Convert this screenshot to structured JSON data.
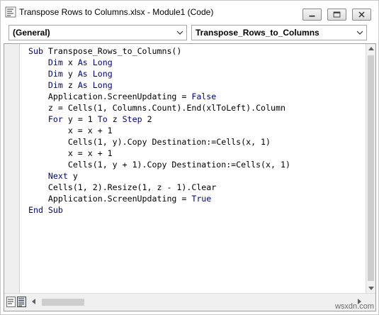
{
  "window": {
    "title": "Transpose Rows to Columns.xlsx - Module1 (Code)",
    "icon": "vba-module-icon"
  },
  "controls": {
    "minimize": "minimize-icon",
    "maximize": "maximize-icon",
    "close": "close-icon"
  },
  "toolbar": {
    "object_combo": "(General)",
    "procedure_combo": "Transpose_Rows_to_Columns"
  },
  "code": {
    "lines": [
      "Sub Transpose_Rows_to_Columns()",
      "    Dim x As Long",
      "    Dim y As Long",
      "    Dim z As Long",
      "    Application.ScreenUpdating = False",
      "    z = Cells(1, Columns.Count).End(xlToLeft).Column",
      "    For y = 1 To z Step 2",
      "        x = x + 1",
      "        Cells(1, y).Copy Destination:=Cells(x, 1)",
      "        x = x + 1",
      "        Cells(1, y + 1).Copy Destination:=Cells(x, 1)",
      "    Next y",
      "    Cells(1, 2).Resize(1, z - 1).Clear",
      "    Application.ScreenUpdating = True",
      "End Sub"
    ]
  },
  "colors": {
    "keyword": "#00008b",
    "text": "#000000"
  },
  "watermark": "wsxdn.com"
}
